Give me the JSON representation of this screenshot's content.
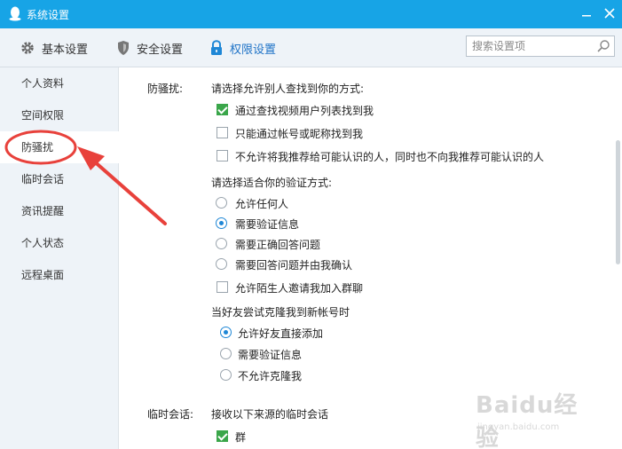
{
  "window": {
    "title": "系统设置"
  },
  "toolbar": {
    "tabs": [
      {
        "label": "基本设置",
        "icon": "gear-icon"
      },
      {
        "label": "安全设置",
        "icon": "shield-icon"
      },
      {
        "label": "权限设置",
        "icon": "lock-icon",
        "active": true
      }
    ],
    "search_placeholder": "搜索设置项",
    "search_value": ""
  },
  "sidebar": {
    "items": [
      {
        "label": "个人资料"
      },
      {
        "label": "空间权限"
      },
      {
        "label": "防骚扰",
        "active": true
      },
      {
        "label": "临时会话"
      },
      {
        "label": "资讯提醒"
      },
      {
        "label": "个人状态"
      },
      {
        "label": "远程桌面"
      }
    ]
  },
  "anti_harass": {
    "section_label": "防骚扰:",
    "find_prompt": "请选择允许别人查找到你的方式:",
    "find_options": [
      {
        "label": "通过查找视频用户列表找到我",
        "checked": true
      },
      {
        "label": "只能通过帐号或昵称找到我",
        "checked": false
      },
      {
        "label": "不允许将我推荐给可能认识的人，同时也不向我推荐可能认识的人",
        "checked": false
      }
    ],
    "verify_prompt": "请选择适合你的验证方式:",
    "verify_options": [
      {
        "label": "允许任何人",
        "selected": false
      },
      {
        "label": "需要验证信息",
        "selected": true
      },
      {
        "label": "需要正确回答问题",
        "selected": false
      },
      {
        "label": "需要回答问题并由我确认",
        "selected": false
      }
    ],
    "group_invite": {
      "label": "允许陌生人邀请我加入群聊",
      "checked": false
    },
    "clone_prompt": "当好友尝试克隆我到新帐号时",
    "clone_options": [
      {
        "label": "允许好友直接添加",
        "selected": true
      },
      {
        "label": "需要验证信息",
        "selected": false
      },
      {
        "label": "不允许克隆我",
        "selected": false
      }
    ]
  },
  "temp_session": {
    "section_label": "临时会话:",
    "prompt": "接收以下来源的临时会话",
    "options": [
      {
        "label": "群",
        "checked": true
      }
    ]
  },
  "watermark": {
    "brand": "Baidu经验",
    "url": "jingyan.baidu.com"
  },
  "colors": {
    "titlebar": "#17a4e6",
    "accent": "#1f73c7",
    "check_green": "#3aa64a",
    "annotation_red": "#e8413b"
  }
}
